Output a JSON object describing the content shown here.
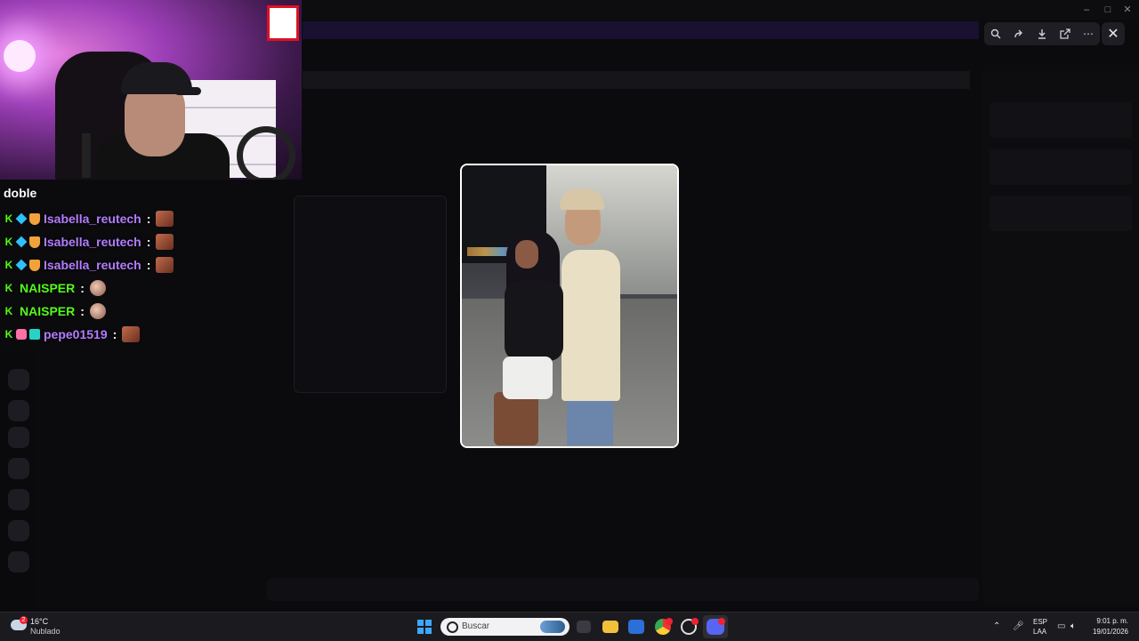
{
  "viewer": {
    "toolbar_icons": [
      "zoom-icon",
      "forward-icon",
      "download-icon",
      "open-external-icon",
      "more-icon"
    ],
    "close_icon": "close-icon"
  },
  "chat": {
    "previous_message_tail": "doble",
    "messages": [
      {
        "user": "Isabella_reutech",
        "badges": [
          "kick",
          "cube",
          "shield"
        ],
        "separator": ":",
        "emote": "emote"
      },
      {
        "user": "Isabella_reutech",
        "badges": [
          "kick",
          "cube",
          "shield"
        ],
        "separator": ":",
        "emote": "emote"
      },
      {
        "user": "Isabella_reutech",
        "badges": [
          "kick",
          "cube",
          "shield"
        ],
        "separator": ":",
        "emote": "emote"
      },
      {
        "user": "NAISPER",
        "badges": [
          "kick"
        ],
        "separator": ":",
        "emote": "emote"
      },
      {
        "user": "NAISPER",
        "badges": [
          "kick"
        ],
        "separator": ":",
        "emote": "emote"
      },
      {
        "user": "pepe01519",
        "badges": [
          "kick",
          "pink",
          "teal"
        ],
        "separator": ":",
        "emote": "emote"
      }
    ],
    "colors": {
      "purple": "#b47cff",
      "green": "#53fc18"
    }
  },
  "taskbar": {
    "weather_temp": "16°C",
    "weather_condition": "Nublado",
    "weather_badge": "2",
    "search_placeholder": "Buscar",
    "lang_line1": "ESP",
    "lang_line2": "LAA",
    "time": "9:01 p. m.",
    "date": "19/01/2026"
  }
}
